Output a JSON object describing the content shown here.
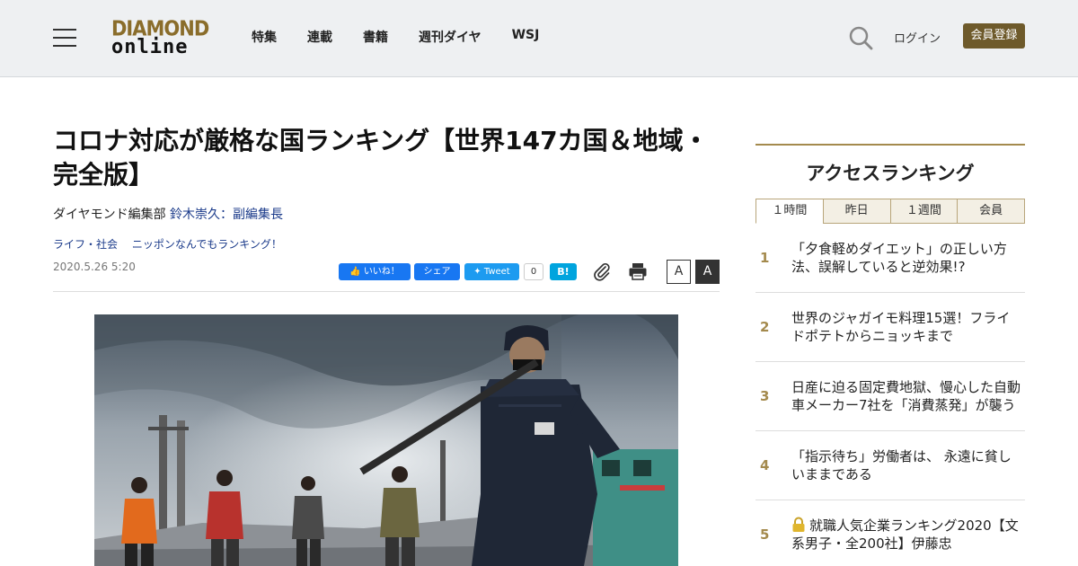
{
  "header": {
    "logo_top": "DIAMOND",
    "logo_bottom": "online",
    "nav": [
      "特集",
      "連載",
      "書籍",
      "週刊ダイヤ",
      "WSJ"
    ],
    "login_label": "ログイン",
    "register_label": "会員登録"
  },
  "article": {
    "title": "コロナ対応が厳格な国ランキング【世界147カ国＆地域・完全版】",
    "byline_prefix": "ダイヤモンド編集部",
    "author": "鈴木崇久：副編集長",
    "tags": [
      "ライフ・社会",
      "ニッポンなんでもランキング！"
    ],
    "date": "2020.5.26 5:20"
  },
  "share": {
    "like_label": "いいね！",
    "share_label": "シェア",
    "tweet_label": "Tweet",
    "tweet_count": "0",
    "hatena_label": "B!",
    "font_small": "A",
    "font_large": "A"
  },
  "sidebar": {
    "title": "アクセスランキング",
    "tabs": [
      "１時間",
      "昨日",
      "１週間",
      "会員"
    ],
    "active_tab": "１時間",
    "items": [
      {
        "rank": "1",
        "text": "「夕食軽めダイエット」の正しい方法、誤解していると逆効果!?"
      },
      {
        "rank": "2",
        "text": "世界のジャガイモ料理15選！フライドポテトからニョッキまで"
      },
      {
        "rank": "3",
        "text": "日産に迫る固定費地獄、慢心した自動車メーカー7社を「消費蒸発」が襲う"
      },
      {
        "rank": "4",
        "text": "「指示待ち」労働者は、 永遠に貧しいままである"
      },
      {
        "rank": "5",
        "text": "就職人気企業ランキング2020【文系男子・全200社】伊藤忠"
      }
    ]
  },
  "colors": {
    "accent_gold": "#a48a4d",
    "register_bg": "#6e5a2b",
    "link_blue": "#1a3a8a"
  }
}
